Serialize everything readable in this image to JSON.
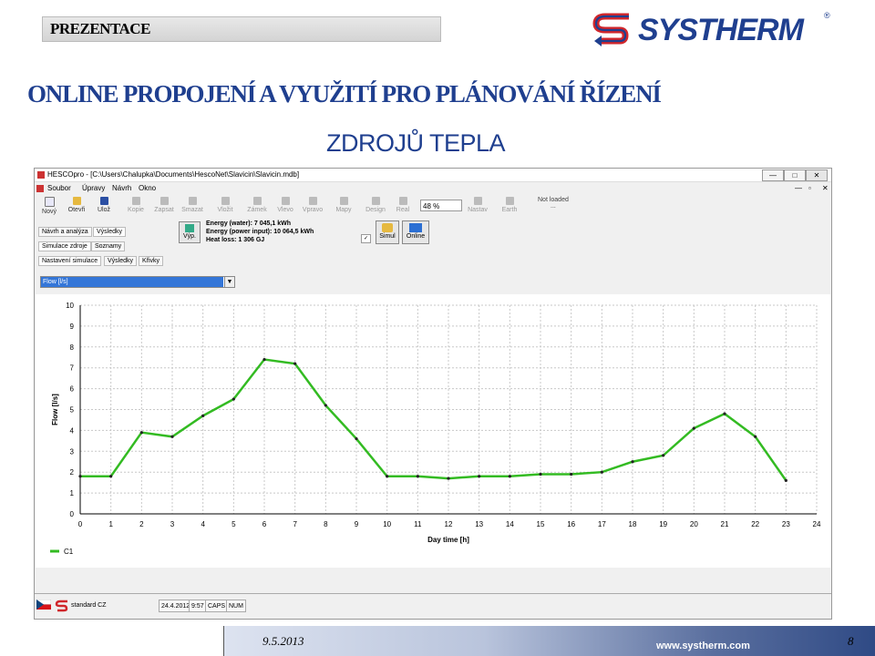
{
  "header": {
    "section_label": "PREZENTACE",
    "brand": "SYSTHERM",
    "brand_mark": "®",
    "title_line1": "ONLINE PROPOJENÍ A VYUŽITÍ PRO PLÁNOVÁNÍ ŘÍZENÍ",
    "title_line2": "ZDROJŮ TEPLA"
  },
  "colors": {
    "title": "#1f3f8f",
    "brand_red": "#d0262b",
    "brand_blue": "#1f3f8f",
    "series_green": "#33bb22",
    "selection_blue": "#3476d8"
  },
  "app": {
    "window_title": "HESCOpro - [C:\\Users\\Chalupka\\Documents\\HescoNet\\Slavicin\\Slavicin.mdb]",
    "window_controls": [
      "—",
      "□",
      "✕"
    ],
    "inner_controls": [
      "—",
      "▫",
      "✕"
    ],
    "menu": [
      "Soubor",
      "Úpravy",
      "Návrh",
      "Okno"
    ],
    "toolbar": [
      {
        "label": "Nový",
        "icon": "new-file-icon",
        "enabled": true
      },
      {
        "label": "Otevři",
        "icon": "open-folder-icon",
        "enabled": true
      },
      {
        "label": "Ulož",
        "icon": "save-icon",
        "enabled": true
      },
      {
        "label": "Kopie",
        "icon": "copy-icon",
        "enabled": false
      },
      {
        "label": "Zapsat",
        "icon": "write-icon",
        "enabled": false
      },
      {
        "label": "Smazat",
        "icon": "delete-icon",
        "enabled": false
      },
      {
        "label": "Vložit",
        "icon": "paste-icon",
        "enabled": false
      },
      {
        "label": "Zámek",
        "icon": "lock-icon",
        "enabled": false
      },
      {
        "label": "Vlevo",
        "icon": "rotate-left-icon",
        "enabled": false
      },
      {
        "label": "Vpravo",
        "icon": "rotate-right-icon",
        "enabled": false
      },
      {
        "label": "Mapy",
        "icon": "map-icon",
        "enabled": false
      },
      {
        "label": "Design",
        "icon": "design-icon",
        "enabled": false
      },
      {
        "label": "Real",
        "icon": "real-icon",
        "enabled": false
      },
      {
        "label": "Nastav",
        "icon": "settings-icon",
        "enabled": false
      },
      {
        "label": "Earth",
        "icon": "earth-icon",
        "enabled": false
      }
    ],
    "zoom": "48 %",
    "map_status": "Not loaded",
    "map_status_sub": "...",
    "tabs_row1": [
      "Návrh a analýza",
      "Výsledky"
    ],
    "tabs_row2": [
      "Simulace zdroje",
      "Soznamy"
    ],
    "tabs_row3": [
      "Nastavení simulace",
      "Výsledky",
      "Křivky"
    ],
    "vyp_label": "Výp.",
    "stats": {
      "energy_water": "Energy (water):  7 045,1 kWh",
      "energy_power": "Energy (power input):  10 064,5 kWh",
      "heat_loss": "Heat loss:  1 306 GJ"
    },
    "simul_label": "Simul",
    "online_label": "Online",
    "checkbox_mark": "✓",
    "dropdown_value": "Flow [l/s]",
    "dropdown_arrow": "▼",
    "statusbar": {
      "profile": "standard CZ",
      "date": "24.4.2012",
      "time": "9:57",
      "caps": "CAPS",
      "num": "NUM"
    }
  },
  "chart_data": {
    "type": "line",
    "title": "",
    "xlabel": "Day time [h]",
    "ylabel": "Flow [l/s]",
    "xlim": [
      0,
      24
    ],
    "ylim": [
      0,
      10
    ],
    "xticks": [
      0,
      1,
      2,
      3,
      4,
      5,
      6,
      7,
      8,
      9,
      10,
      11,
      12,
      13,
      14,
      15,
      16,
      17,
      18,
      19,
      20,
      21,
      22,
      23,
      24
    ],
    "yticks": [
      0,
      1,
      2,
      3,
      4,
      5,
      6,
      7,
      8,
      9,
      10
    ],
    "grid": true,
    "legend_position": "bottom-left",
    "series": [
      {
        "name": "C1",
        "color": "#33bb22",
        "x": [
          0,
          1,
          2,
          3,
          4,
          5,
          6,
          7,
          8,
          9,
          10,
          11,
          12,
          13,
          14,
          15,
          16,
          17,
          18,
          19,
          20,
          21,
          22,
          23
        ],
        "y": [
          1.8,
          1.8,
          3.9,
          3.7,
          4.7,
          5.5,
          7.4,
          7.2,
          5.2,
          3.6,
          1.8,
          1.8,
          1.7,
          1.8,
          1.8,
          1.9,
          1.9,
          2.0,
          2.5,
          2.8,
          4.1,
          4.8,
          3.7,
          1.6
        ]
      }
    ]
  },
  "footer": {
    "date": "9.5.2013",
    "url": "www.systherm.com",
    "page": "8"
  }
}
